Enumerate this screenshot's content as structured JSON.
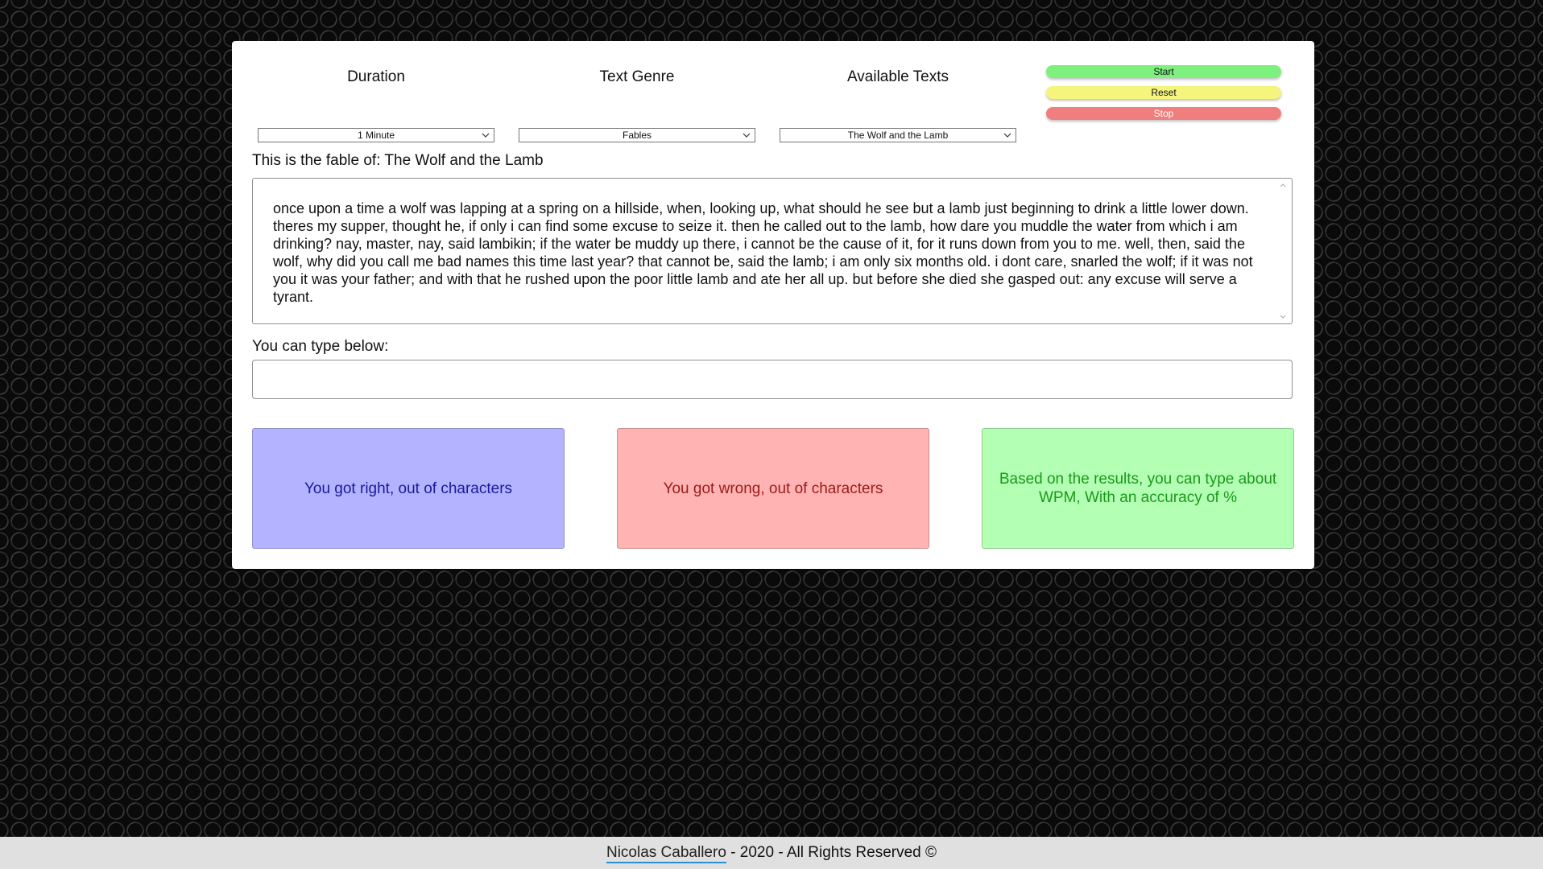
{
  "controls": {
    "duration": {
      "title": "Duration",
      "selected": "1 Minute"
    },
    "genre": {
      "title": "Text Genre",
      "selected": "Fables"
    },
    "texts": {
      "title": "Available Texts",
      "selected": "The Wolf and the Lamb"
    }
  },
  "buttons": {
    "start": "Start",
    "reset": "Reset",
    "stop": "Stop"
  },
  "colors": {
    "start": "#7ef07e",
    "reset": "#f5f57e",
    "stop": "#f07e7e",
    "right_box": "#b3b3ff",
    "wrong_box": "#ffb3b3",
    "summary_box": "#b3ffb3"
  },
  "fable": {
    "heading": "This is the fable of: The Wolf and the Lamb",
    "text": "once upon a time a wolf was lapping at a spring on a hillside, when, looking up, what should he see but a lamb just beginning to drink a little lower down. theres my supper, thought he, if only i can find some excuse to seize it. then he called out to the lamb, how dare you muddle the water from which i am drinking? nay, master, nay, said lambikin; if the water be muddy up there, i cannot be the cause of it, for it runs down from you to me. well, then, said the wolf, why did you call me bad names this time last year? that cannot be, said the lamb; i am only six months old. i dont care, snarled the wolf; if it was not you it was your father; and with that he rushed upon the poor little lamb and ate her all up. but before she died she gasped out: any excuse will serve a tyrant."
  },
  "typing": {
    "label": "You can type below:",
    "value": ""
  },
  "results": {
    "right": "You got right, out of characters",
    "wrong": "You got wrong, out of characters",
    "summary": "Based on the results, you can type about WPM, With an accuracy of %"
  },
  "footer": {
    "author": "Nicolas Caballero",
    "rights": " - 2020 - All Rights Reserved ©"
  }
}
